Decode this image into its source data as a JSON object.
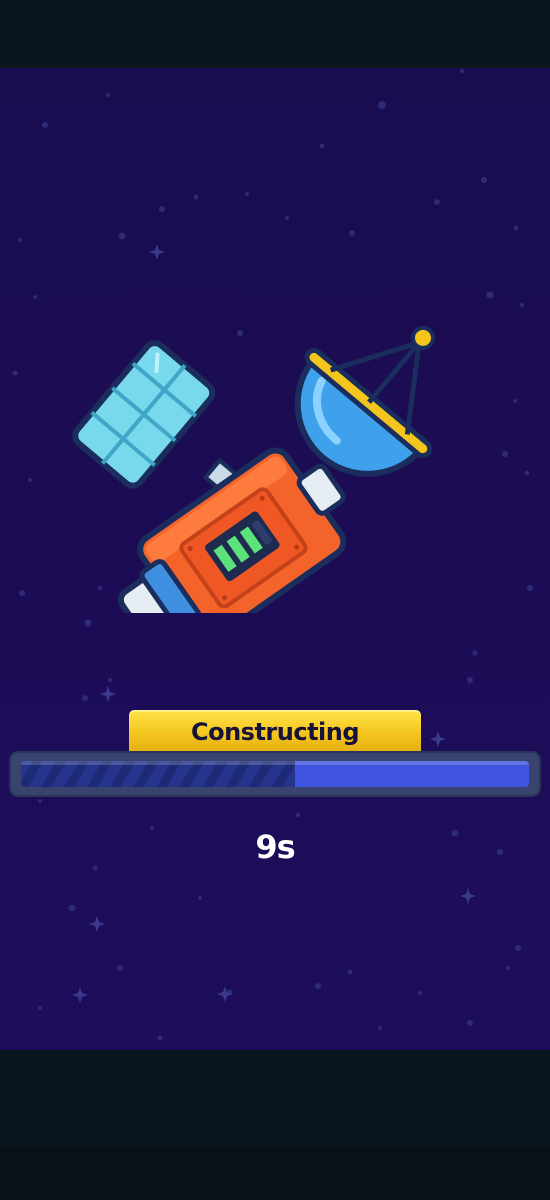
{
  "status": {
    "label": "Constructing"
  },
  "progress": {
    "fraction": 0.54
  },
  "timer": {
    "remaining": "9s"
  },
  "colors": {
    "background_top": "#190c4f",
    "background_bottom": "#1e0d5a",
    "status_tab": "#f4c51d",
    "progress_fill": "#3f55e0",
    "progress_track": "#39446e"
  },
  "icons": {
    "satellite": "satellite-icon"
  }
}
